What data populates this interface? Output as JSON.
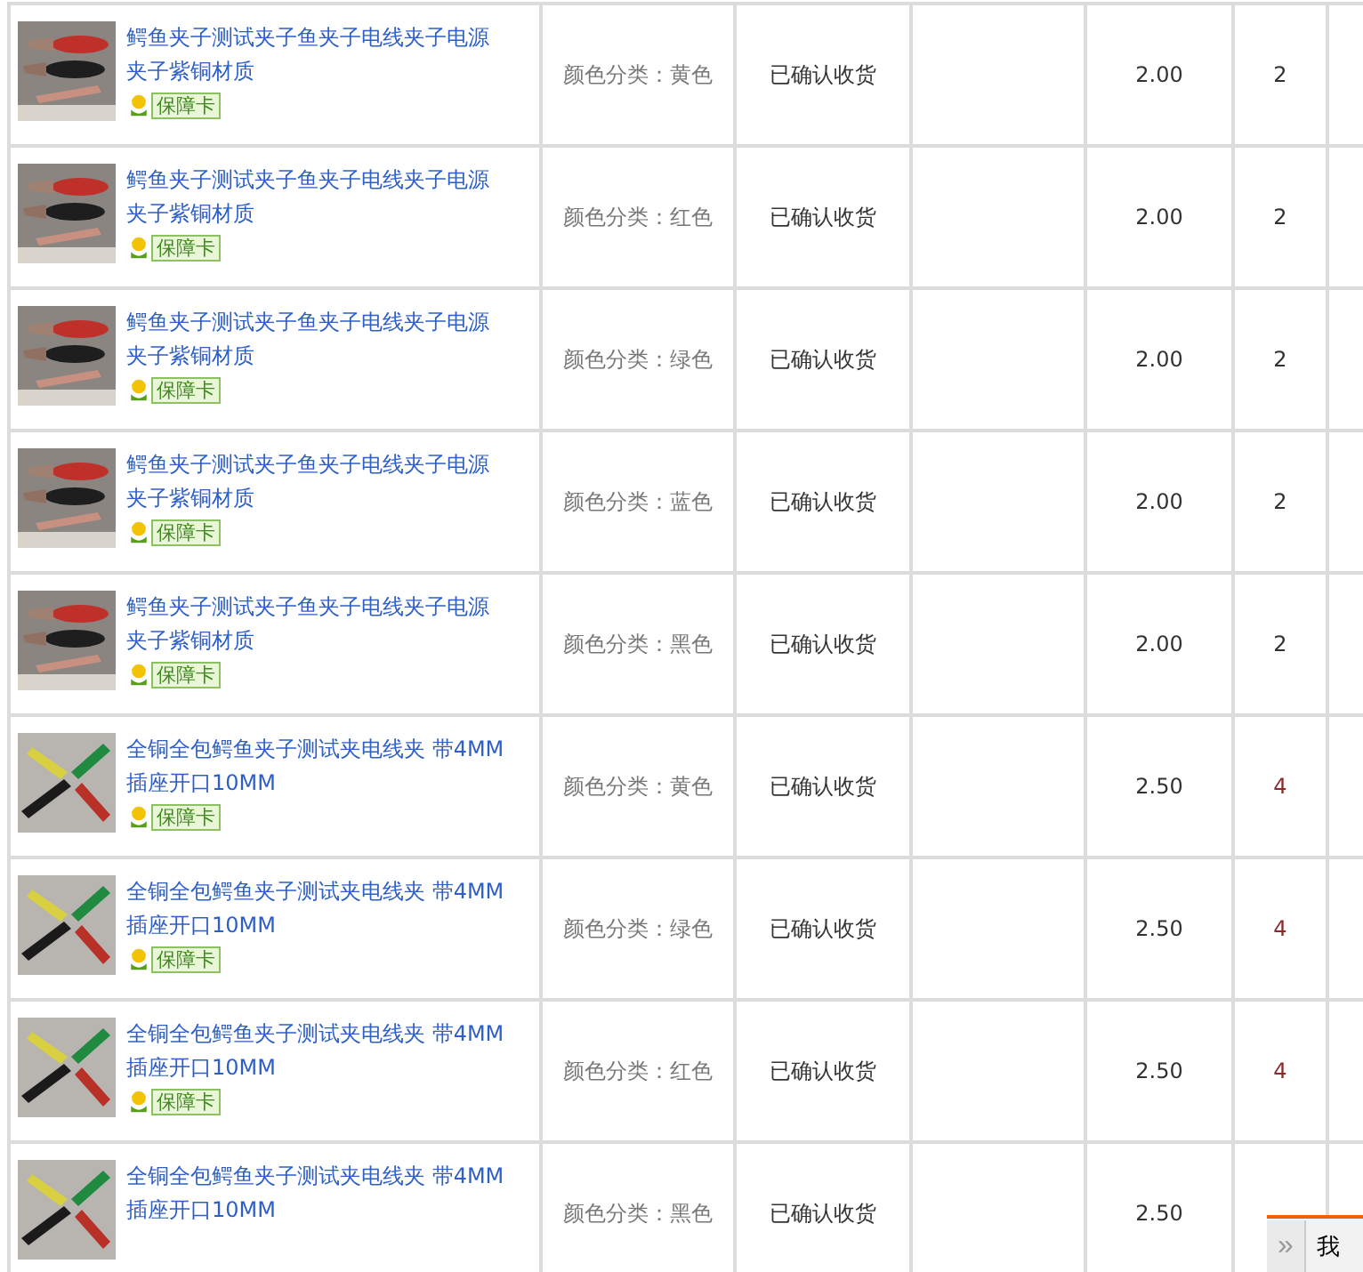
{
  "orders": [
    {
      "title": "鳄鱼夹子测试夹子鱼夹子电线夹子电源夹子紫铜材质",
      "badge": "保障卡",
      "spec": "颜色分类：黄色",
      "status": "已确认收货",
      "price": "2.00",
      "quantity": "2",
      "quantity_highlighted": false
    },
    {
      "title": "鳄鱼夹子测试夹子鱼夹子电线夹子电源夹子紫铜材质",
      "badge": "保障卡",
      "spec": "颜色分类：红色",
      "status": "已确认收货",
      "price": "2.00",
      "quantity": "2",
      "quantity_highlighted": false
    },
    {
      "title": "鳄鱼夹子测试夹子鱼夹子电线夹子电源夹子紫铜材质",
      "badge": "保障卡",
      "spec": "颜色分类：绿色",
      "status": "已确认收货",
      "price": "2.00",
      "quantity": "2",
      "quantity_highlighted": false
    },
    {
      "title": "鳄鱼夹子测试夹子鱼夹子电线夹子电源夹子紫铜材质",
      "badge": "保障卡",
      "spec": "颜色分类：蓝色",
      "status": "已确认收货",
      "price": "2.00",
      "quantity": "2",
      "quantity_highlighted": false
    },
    {
      "title": "鳄鱼夹子测试夹子鱼夹子电线夹子电源夹子紫铜材质",
      "badge": "保障卡",
      "spec": "颜色分类：黑色",
      "status": "已确认收货",
      "price": "2.00",
      "quantity": "2",
      "quantity_highlighted": false
    },
    {
      "title": "全铜全包鳄鱼夹子测试夹电线夹 带4MM插座开口10MM",
      "badge": "保障卡",
      "spec": "颜色分类：黄色",
      "status": "已确认收货",
      "price": "2.50",
      "quantity": "4",
      "quantity_highlighted": true
    },
    {
      "title": "全铜全包鳄鱼夹子测试夹电线夹 带4MM插座开口10MM",
      "badge": "保障卡",
      "spec": "颜色分类：绿色",
      "status": "已确认收货",
      "price": "2.50",
      "quantity": "4",
      "quantity_highlighted": true
    },
    {
      "title": "全铜全包鳄鱼夹子测试夹电线夹 带4MM插座开口10MM",
      "badge": "保障卡",
      "spec": "颜色分类：红色",
      "status": "已确认收货",
      "price": "2.50",
      "quantity": "4",
      "quantity_highlighted": true
    },
    {
      "title": "全铜全包鳄鱼夹子测试夹电线夹 带4MM插座开口10MM",
      "spec": "颜色分类：黑色",
      "status": "已确认收货",
      "price": "2.50"
    }
  ],
  "float_bar": {
    "toggle": "»",
    "label": "我"
  }
}
